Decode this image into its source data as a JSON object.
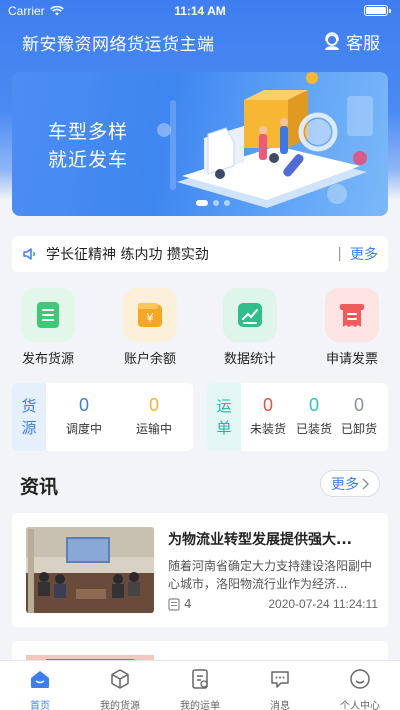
{
  "status_bar": {
    "carrier": "Carrier",
    "time": "11:14 AM"
  },
  "header": {
    "title": "新安豫资网络货运货主端",
    "service_label": "客服"
  },
  "banner": {
    "slogan_line1": "车型多样",
    "slogan_line2": "就近发车"
  },
  "notice": {
    "text": "学长征精神 练内功 攒实劲",
    "more_label": "更多",
    "separator": "|"
  },
  "quick_actions": [
    {
      "label": "发布货源",
      "icon": "list-icon",
      "color": "#3ec97a",
      "bg": "#e3f6ea"
    },
    {
      "label": "账户余额",
      "icon": "wallet-icon",
      "color": "#f5a623",
      "bg": "#fdf0d9"
    },
    {
      "label": "数据统计",
      "icon": "chart-icon",
      "color": "#2fbf8c",
      "bg": "#def5ec"
    },
    {
      "label": "申请发票",
      "icon": "invoice-icon",
      "color": "#ef5a5a",
      "bg": "#fde3e3"
    }
  ],
  "source_stats": {
    "side_label_1": "货",
    "side_label_2": "源",
    "items": [
      {
        "value": "0",
        "label": "调度中",
        "color": "#3d7ff0"
      },
      {
        "value": "0",
        "label": "运输中",
        "color": "#f5b52e"
      }
    ]
  },
  "waybill_stats": {
    "side_label_1": "运",
    "side_label_2": "单",
    "items": [
      {
        "value": "0",
        "label": "未装货",
        "color": "#e8503c"
      },
      {
        "value": "0",
        "label": "已装货",
        "color": "#30c4b2"
      },
      {
        "value": "0",
        "label": "已卸货",
        "color": "#8a8f99"
      }
    ]
  },
  "news": {
    "heading": "资讯",
    "more_label": "更多",
    "items": [
      {
        "title": "为物流业转型发展提供强大...",
        "description": "随着河南省确定大力支持建设洛阳副中心城市，洛阳物流行业作为经济...",
        "view_count": "4",
        "date": "2020-07-24 11:24:11"
      }
    ]
  },
  "tabbar": [
    {
      "label": "首页",
      "icon": "home-icon",
      "active": true
    },
    {
      "label": "我的货源",
      "icon": "cube-icon",
      "active": false
    },
    {
      "label": "我的运单",
      "icon": "waybill-icon",
      "active": false
    },
    {
      "label": "消息",
      "icon": "message-icon",
      "active": false
    },
    {
      "label": "个人中心",
      "icon": "profile-icon",
      "active": false
    }
  ],
  "colors": {
    "primary": "#3d7ff0",
    "background": "#f3f4f7"
  }
}
